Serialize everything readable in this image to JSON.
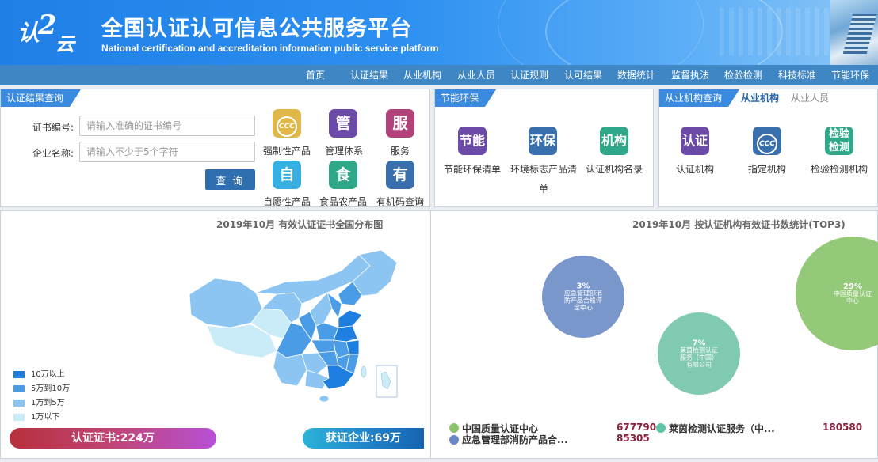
{
  "header": {
    "logo_chars": [
      "认",
      "2",
      "云"
    ],
    "title": "全国认证认可信息公共服务平台",
    "subtitle": "National certification and accreditation information public service platform"
  },
  "nav": {
    "items": [
      "首页",
      "认证结果",
      "从业机构",
      "从业人员",
      "认证规则",
      "认可结果",
      "数据统计",
      "监督执法",
      "检验检测",
      "科技标准",
      "节能环保"
    ]
  },
  "cert_query": {
    "tag": "认证结果查询",
    "cert_no_label": "证书编号:",
    "cert_no_placeholder": "请输入准确的证书编号",
    "company_label": "企业名称:",
    "company_placeholder": "请输入不少于5个字符",
    "query_button": "查 询",
    "tiles": [
      {
        "icon": "ccc-icon",
        "glyph": "CCC",
        "label": "强制性产品",
        "color": "#e0b84a"
      },
      {
        "icon": "management-icon",
        "glyph": "管",
        "label": "管理体系",
        "color": "#6b4aa8"
      },
      {
        "icon": "service-icon",
        "glyph": "服",
        "label": "服务",
        "color": "#b2437a"
      },
      {
        "icon": "voluntary-icon",
        "glyph": "自",
        "label": "自愿性产品",
        "color": "#35b0e0"
      },
      {
        "icon": "food-icon",
        "glyph": "食",
        "label": "食品农产品",
        "color": "#2ea889"
      },
      {
        "icon": "organic-icon",
        "glyph": "有",
        "label": "有机码查询",
        "color": "#3a6fae"
      }
    ]
  },
  "energy": {
    "tag": "节能环保",
    "tiles": [
      {
        "icon": "energy-saving-icon",
        "glyph": "节能",
        "label": "节能环保清单",
        "color": "#6b4aa8"
      },
      {
        "icon": "environment-icon",
        "glyph": "环保",
        "label_line1": "环境标志产品清",
        "label_line2": "单",
        "color": "#3a6fae"
      },
      {
        "icon": "institution-icon",
        "glyph": "机构",
        "label": "认证机构名录",
        "color": "#2ea889"
      }
    ]
  },
  "org_query": {
    "tag": "从业机构查询",
    "tab_active": "从业机构",
    "tab_inactive": "从业人员",
    "tiles": [
      {
        "icon": "certification-icon",
        "glyph": "认证",
        "label": "认证机构",
        "color": "#6b4aa8"
      },
      {
        "icon": "designated-icon",
        "glyph": "CCC",
        "label": "指定机构",
        "color": "#3a6fae"
      },
      {
        "icon": "inspection-icon",
        "glyph1": "检验",
        "glyph2": "检测",
        "label": "检验检测机构",
        "color": "#2ea889"
      }
    ]
  },
  "map_panel": {
    "title": "2019年10月  有效认证证书全国分布图",
    "legend": [
      {
        "label": "10万以上",
        "color": "#1f7fe0"
      },
      {
        "label": "5万到10万",
        "color": "#4a9ce6"
      },
      {
        "label": "1万到5万",
        "color": "#8cc4f2"
      },
      {
        "label": "1万以下",
        "color": "#c9ecf8"
      }
    ],
    "cert_total": "认证证书:224万",
    "company_total": "获证企业:69万"
  },
  "stats_panel": {
    "title": "2019年10月    按认证机构有效证书数统计(TOP3)",
    "chart_data": {
      "type": "bubble",
      "title": "2019年10月    按认证机构有效证书数统计(TOP3)",
      "series": [
        {
          "name": "中国质量认证中心",
          "percent": 29,
          "value": 677790,
          "color": "#94c97a",
          "label_lines": [
            "29%",
            "中国质量认证",
            "中心"
          ]
        },
        {
          "name": "莱茵检测认证服务（中国）有限公司",
          "percent": 7,
          "value": 180580,
          "color": "#7fcab0",
          "label_lines": [
            "7%",
            "莱茵检测认证",
            "服务（中国）",
            "有限公司"
          ]
        },
        {
          "name": "应急管理部消防产品合格评定中心",
          "percent": 3,
          "value": 85305,
          "color": "#7a97cc",
          "label_lines": [
            "3%",
            "应急管理部消",
            "防产品合格评",
            "定中心"
          ]
        }
      ]
    },
    "ranking": [
      {
        "name": "中国质量认证中心",
        "value": "677790",
        "color": "#8cc36a"
      },
      {
        "name": "莱茵检测认证服务（中...",
        "value": "180580",
        "color": "#5fc3a8"
      },
      {
        "name": "应急管理部消防产品合...",
        "value": "85305",
        "color": "#6a86c8"
      }
    ]
  }
}
